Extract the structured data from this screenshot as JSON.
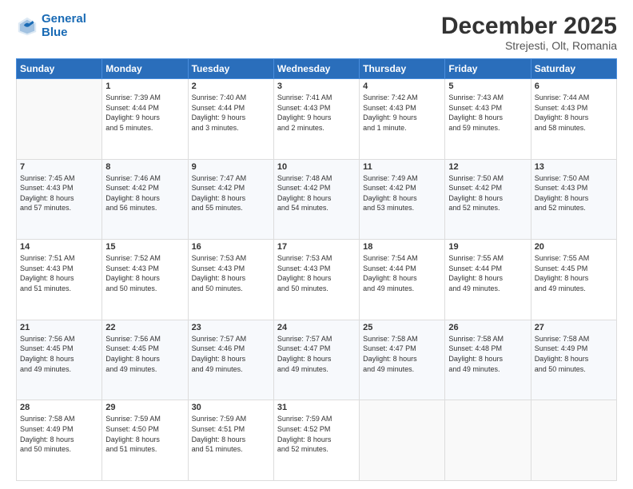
{
  "header": {
    "logo_line1": "General",
    "logo_line2": "Blue",
    "title": "December 2025",
    "subtitle": "Strejesti, Olt, Romania"
  },
  "days_of_week": [
    "Sunday",
    "Monday",
    "Tuesday",
    "Wednesday",
    "Thursday",
    "Friday",
    "Saturday"
  ],
  "weeks": [
    [
      {
        "day": "",
        "text": ""
      },
      {
        "day": "1",
        "text": "Sunrise: 7:39 AM\nSunset: 4:44 PM\nDaylight: 9 hours\nand 5 minutes."
      },
      {
        "day": "2",
        "text": "Sunrise: 7:40 AM\nSunset: 4:44 PM\nDaylight: 9 hours\nand 3 minutes."
      },
      {
        "day": "3",
        "text": "Sunrise: 7:41 AM\nSunset: 4:43 PM\nDaylight: 9 hours\nand 2 minutes."
      },
      {
        "day": "4",
        "text": "Sunrise: 7:42 AM\nSunset: 4:43 PM\nDaylight: 9 hours\nand 1 minute."
      },
      {
        "day": "5",
        "text": "Sunrise: 7:43 AM\nSunset: 4:43 PM\nDaylight: 8 hours\nand 59 minutes."
      },
      {
        "day": "6",
        "text": "Sunrise: 7:44 AM\nSunset: 4:43 PM\nDaylight: 8 hours\nand 58 minutes."
      }
    ],
    [
      {
        "day": "7",
        "text": "Sunrise: 7:45 AM\nSunset: 4:43 PM\nDaylight: 8 hours\nand 57 minutes."
      },
      {
        "day": "8",
        "text": "Sunrise: 7:46 AM\nSunset: 4:42 PM\nDaylight: 8 hours\nand 56 minutes."
      },
      {
        "day": "9",
        "text": "Sunrise: 7:47 AM\nSunset: 4:42 PM\nDaylight: 8 hours\nand 55 minutes."
      },
      {
        "day": "10",
        "text": "Sunrise: 7:48 AM\nSunset: 4:42 PM\nDaylight: 8 hours\nand 54 minutes."
      },
      {
        "day": "11",
        "text": "Sunrise: 7:49 AM\nSunset: 4:42 PM\nDaylight: 8 hours\nand 53 minutes."
      },
      {
        "day": "12",
        "text": "Sunrise: 7:50 AM\nSunset: 4:42 PM\nDaylight: 8 hours\nand 52 minutes."
      },
      {
        "day": "13",
        "text": "Sunrise: 7:50 AM\nSunset: 4:43 PM\nDaylight: 8 hours\nand 52 minutes."
      }
    ],
    [
      {
        "day": "14",
        "text": "Sunrise: 7:51 AM\nSunset: 4:43 PM\nDaylight: 8 hours\nand 51 minutes."
      },
      {
        "day": "15",
        "text": "Sunrise: 7:52 AM\nSunset: 4:43 PM\nDaylight: 8 hours\nand 50 minutes."
      },
      {
        "day": "16",
        "text": "Sunrise: 7:53 AM\nSunset: 4:43 PM\nDaylight: 8 hours\nand 50 minutes."
      },
      {
        "day": "17",
        "text": "Sunrise: 7:53 AM\nSunset: 4:43 PM\nDaylight: 8 hours\nand 50 minutes."
      },
      {
        "day": "18",
        "text": "Sunrise: 7:54 AM\nSunset: 4:44 PM\nDaylight: 8 hours\nand 49 minutes."
      },
      {
        "day": "19",
        "text": "Sunrise: 7:55 AM\nSunset: 4:44 PM\nDaylight: 8 hours\nand 49 minutes."
      },
      {
        "day": "20",
        "text": "Sunrise: 7:55 AM\nSunset: 4:45 PM\nDaylight: 8 hours\nand 49 minutes."
      }
    ],
    [
      {
        "day": "21",
        "text": "Sunrise: 7:56 AM\nSunset: 4:45 PM\nDaylight: 8 hours\nand 49 minutes."
      },
      {
        "day": "22",
        "text": "Sunrise: 7:56 AM\nSunset: 4:45 PM\nDaylight: 8 hours\nand 49 minutes."
      },
      {
        "day": "23",
        "text": "Sunrise: 7:57 AM\nSunset: 4:46 PM\nDaylight: 8 hours\nand 49 minutes."
      },
      {
        "day": "24",
        "text": "Sunrise: 7:57 AM\nSunset: 4:47 PM\nDaylight: 8 hours\nand 49 minutes."
      },
      {
        "day": "25",
        "text": "Sunrise: 7:58 AM\nSunset: 4:47 PM\nDaylight: 8 hours\nand 49 minutes."
      },
      {
        "day": "26",
        "text": "Sunrise: 7:58 AM\nSunset: 4:48 PM\nDaylight: 8 hours\nand 49 minutes."
      },
      {
        "day": "27",
        "text": "Sunrise: 7:58 AM\nSunset: 4:49 PM\nDaylight: 8 hours\nand 50 minutes."
      }
    ],
    [
      {
        "day": "28",
        "text": "Sunrise: 7:58 AM\nSunset: 4:49 PM\nDaylight: 8 hours\nand 50 minutes."
      },
      {
        "day": "29",
        "text": "Sunrise: 7:59 AM\nSunset: 4:50 PM\nDaylight: 8 hours\nand 51 minutes."
      },
      {
        "day": "30",
        "text": "Sunrise: 7:59 AM\nSunset: 4:51 PM\nDaylight: 8 hours\nand 51 minutes."
      },
      {
        "day": "31",
        "text": "Sunrise: 7:59 AM\nSunset: 4:52 PM\nDaylight: 8 hours\nand 52 minutes."
      },
      {
        "day": "",
        "text": ""
      },
      {
        "day": "",
        "text": ""
      },
      {
        "day": "",
        "text": ""
      }
    ]
  ]
}
